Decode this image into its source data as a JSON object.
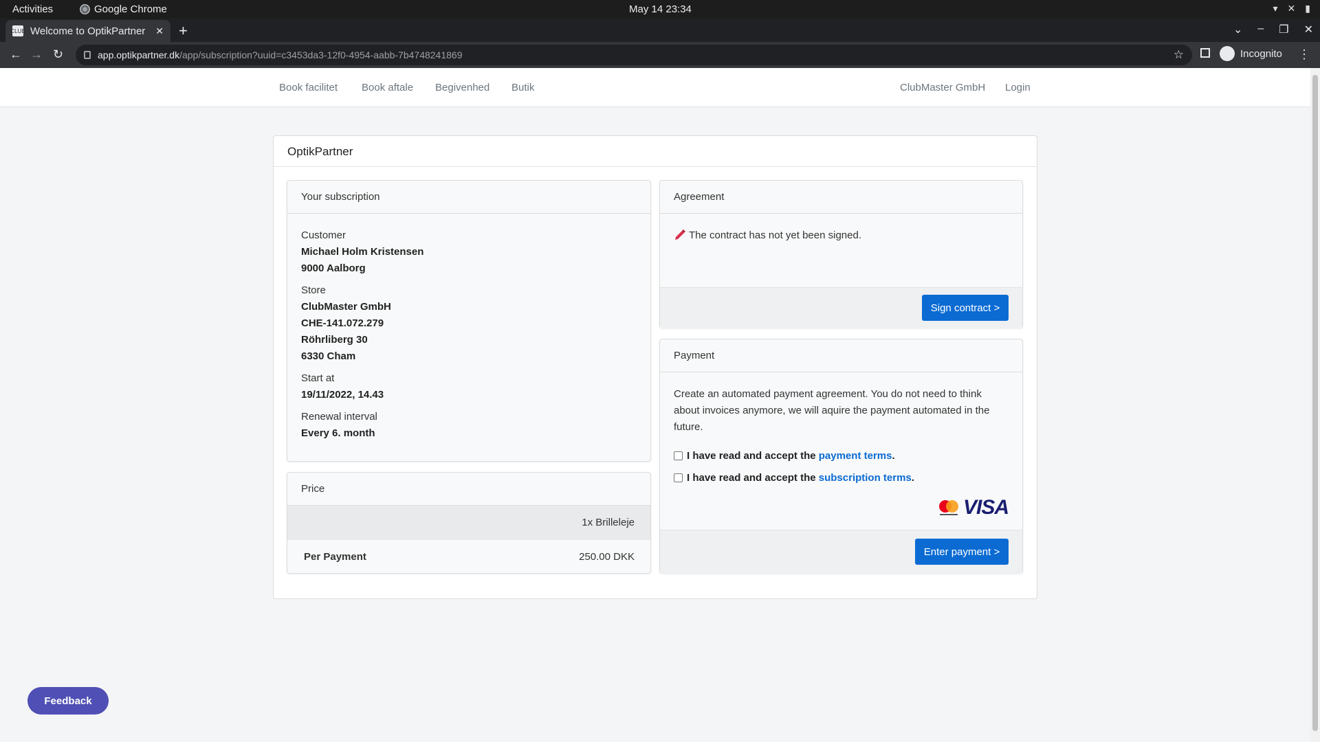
{
  "system": {
    "activities": "Activities",
    "app_name": "Google Chrome",
    "clock": "May 14  23:34"
  },
  "browser": {
    "tab_title": "Welcome to OptikPartner",
    "favicon_text": "CLUB",
    "url_host": "app.optikpartner.dk",
    "url_path": "/app/subscription?uuid=c3453da3-12f0-4954-aabb-7b4748241869",
    "profile_label": "Incognito"
  },
  "site_nav": {
    "left_items": [
      "Book facilitet",
      "Book aftale",
      "Begivenhed",
      "Butik"
    ],
    "company": "ClubMaster GmbH",
    "login": "Login"
  },
  "page": {
    "title": "OptikPartner"
  },
  "subscription": {
    "header": "Your subscription",
    "customer_label": "Customer",
    "customer_name": "Michael Holm Kristensen",
    "customer_city": "9000 Aalborg",
    "store_label": "Store",
    "store_name": "ClubMaster GmbH",
    "store_vat": "CHE-141.072.279",
    "store_street": "Röhrliberg 30",
    "store_city": "6330 Cham",
    "start_label": "Start at",
    "start_value": "19/11/2022, 14.43",
    "renewal_label": "Renewal interval",
    "renewal_value": "Every 6. month"
  },
  "price": {
    "header": "Price",
    "item": "1x Brilleleje",
    "per_payment_label": "Per Payment",
    "per_payment_value": "250.00 DKK"
  },
  "agreement": {
    "header": "Agreement",
    "status": "The contract has not yet been signed.",
    "sign_button": "Sign contract >"
  },
  "payment": {
    "header": "Payment",
    "description": "Create an automated payment agreement. You do not need to think about invoices anymore, we will aquire the payment automated in the future.",
    "terms_prefix": "I have read and accept the",
    "payment_terms_link": "payment terms",
    "subscription_terms_link": "subscription terms",
    "terms_suffix": ".",
    "card_brand": "VISA",
    "enter_button": "Enter payment >"
  },
  "feedback": {
    "label": "Feedback"
  },
  "colors": {
    "primary": "#0b6bd3",
    "feedback": "#4f4fb5",
    "pencil": "#d9304a"
  }
}
